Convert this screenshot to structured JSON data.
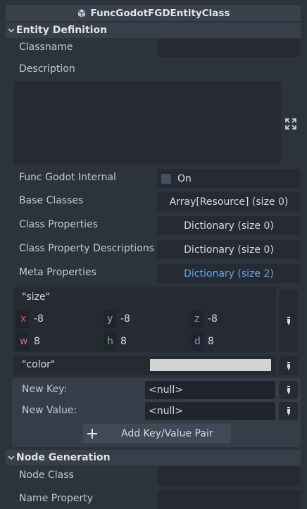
{
  "title": "FuncGodotFGDEntityClass",
  "sections": {
    "entity_definition": "Entity Definition",
    "node_generation": "Node Generation"
  },
  "props": {
    "classname": "Classname",
    "description": "Description",
    "func_godot_internal": "Func Godot Internal",
    "on_label": "On",
    "base_classes": "Base Classes",
    "base_classes_value": "Array[Resource] (size 0)",
    "class_properties": "Class Properties",
    "class_properties_value": "Dictionary (size 0)",
    "class_property_descriptions": "Class Property Descriptions",
    "class_property_descriptions_value": "Dictionary (size 0)",
    "meta_properties": "Meta Properties",
    "meta_properties_value": "Dictionary (size 2)",
    "node_class": "Node Class",
    "name_property": "Name Property"
  },
  "meta": {
    "size_key": "\"size\"",
    "x_label": "x",
    "x_value": "-8",
    "y_label": "y",
    "y_value": "-8",
    "z_label": "z",
    "z_value": "-8",
    "w_label": "w",
    "w_value": "8",
    "h_label": "h",
    "h_value": "8",
    "d_label": "d",
    "d_value": "8",
    "color_key": "\"color\"",
    "color_value": "#d3d3d3"
  },
  "new_entry": {
    "key_label": "New Key:",
    "key_value": "<null>",
    "value_label": "New Value:",
    "value_value": "<null>",
    "add_button": "Add Key/Value Pair"
  },
  "colors": {
    "x": "#d45b5b",
    "y": "#6ec57a",
    "z": "#6e8fd8",
    "w": "#c46bb8",
    "h": "#6ec57a",
    "d": "#9a7ed8",
    "link": "#62a7ee"
  }
}
